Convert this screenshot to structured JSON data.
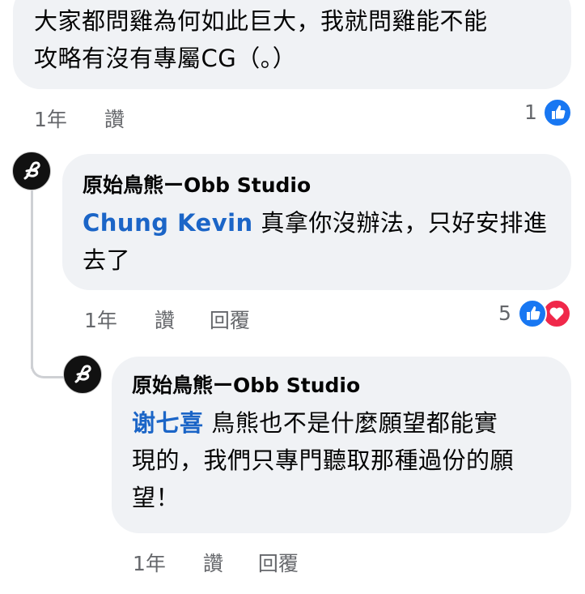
{
  "comments": [
    {
      "text_line1": "大家都問雞為何如此巨大，我就問雞能不能",
      "text_line2": "攻略有沒有專屬CG（。）",
      "time": "1年",
      "like_action": "讚",
      "reaction_count": "1",
      "reactions": [
        "like-icon"
      ]
    },
    {
      "author": "原始鳥熊ーObb Studio",
      "mention": "Chung Kevin",
      "text_line1": "真拿你沒辦法，只好安排進",
      "text_line2": "去了",
      "time": "1年",
      "like_action": "讚",
      "reply_action": "回覆",
      "reaction_count": "5",
      "reactions": [
        "like-icon",
        "love-icon"
      ]
    },
    {
      "author": "原始鳥熊ーObb Studio",
      "mention": "谢七喜",
      "text_line1": "鳥熊也不是什麼願望都能實",
      "text_line2": "現的，我們只專門聽取那種過份的願",
      "text_line3": "望！",
      "time": "1年",
      "like_action": "讚",
      "reply_action": "回覆"
    }
  ],
  "colors": {
    "bubble": "#f0f2f5",
    "mention": "#1b65c7",
    "like": "#1877f2",
    "love": "#f0284a",
    "meta": "#65676b"
  }
}
